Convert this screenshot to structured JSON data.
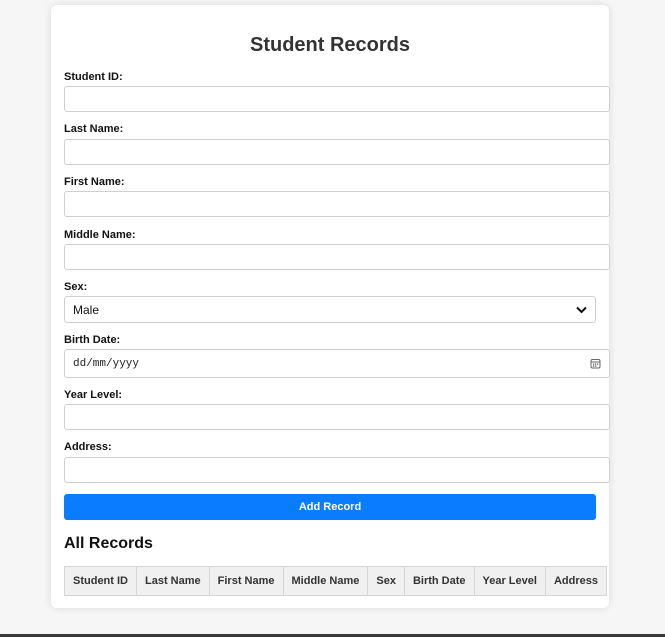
{
  "page_title": "Student Records",
  "form": {
    "student_id": {
      "label": "Student ID:",
      "value": ""
    },
    "last_name": {
      "label": "Last Name:",
      "value": ""
    },
    "first_name": {
      "label": "First Name:",
      "value": ""
    },
    "middle_name": {
      "label": "Middle Name:",
      "value": ""
    },
    "sex": {
      "label": "Sex:",
      "selected": "Male"
    },
    "birth_date": {
      "label": "Birth Date:",
      "placeholder": "dd/mm/yyyy"
    },
    "year_level": {
      "label": "Year Level:",
      "value": ""
    },
    "address": {
      "label": "Address:",
      "value": ""
    },
    "submit_label": "Add Record"
  },
  "records": {
    "title": "All Records",
    "columns": [
      "Student ID",
      "Last Name",
      "First Name",
      "Middle Name",
      "Sex",
      "Birth Date",
      "Year Level",
      "Address"
    ],
    "rows": []
  },
  "colors": {
    "accent": "#0a7cff",
    "background": "#f6f6f6",
    "card": "#ffffff",
    "table_header": "#f0f0f0"
  },
  "icons": {
    "select": "chevron-down-icon",
    "date": "calendar-icon"
  }
}
